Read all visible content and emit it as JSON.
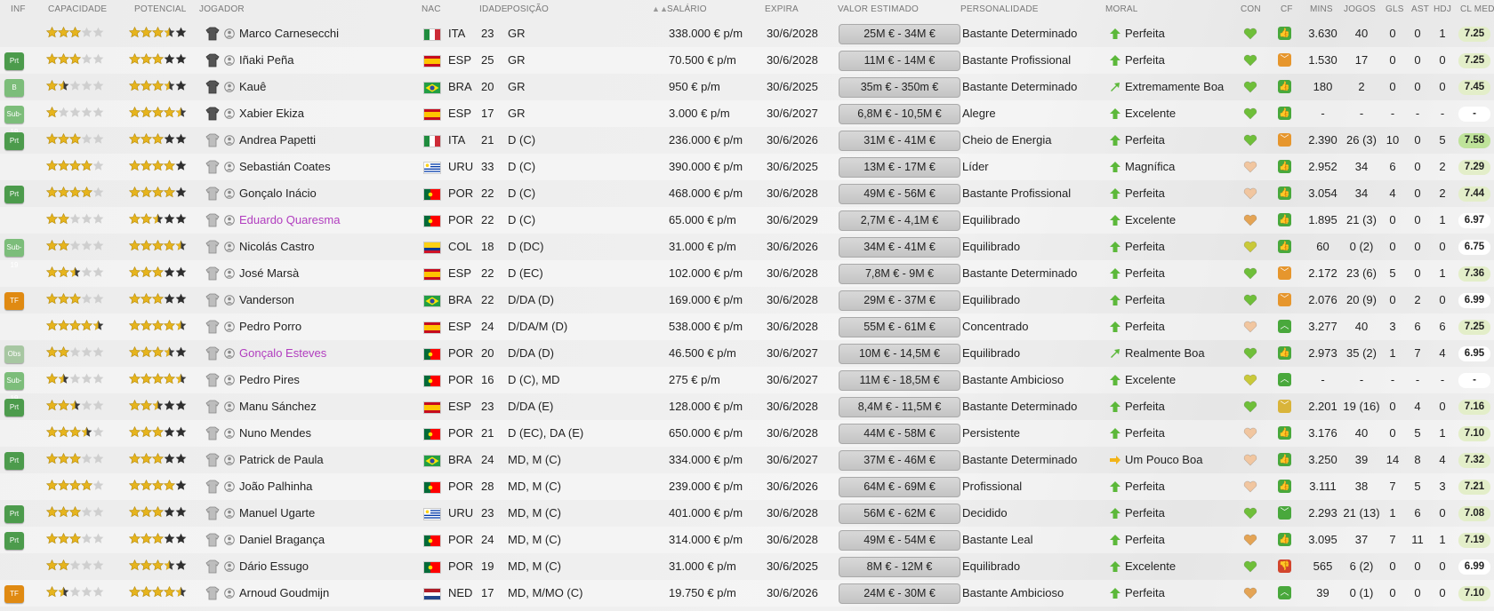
{
  "headers": {
    "inf": "INF",
    "capacidade": "CAPACIDADE",
    "potencial": "POTENCIAL",
    "jogador": "JOGADOR",
    "nac": "NAC",
    "idade": "IDADE",
    "posicao": "POSIÇÃO",
    "salario": "SALÁRIO",
    "expira": "EXPIRA",
    "valor": "VALOR ESTIMADO",
    "personalidade": "PERSONALIDADE",
    "moral": "MORAL",
    "con": "CON",
    "cf": "CF",
    "mins": "MINS",
    "jogos": "JOGOS",
    "gls": "GLS",
    "ast": "AST",
    "hdj": "HDJ",
    "clmed": "CL MED",
    "sort_icon": "sort-ascending-icon"
  },
  "colors": {
    "badge_prt": "#4c9b4c",
    "badge_b": "#7cbd7a",
    "badge_sub19": "#7cbd7a",
    "badge_tf": "#e08a12",
    "badge_obs": "#a7c7a2",
    "star": "#e6b41d",
    "star_empty": "#cfcfcf",
    "pink_name": "#b13dbf",
    "con_green": "#6fbf3a",
    "con_peach": "#f1c6a0",
    "con_orange": "#e4a455",
    "con_yellow": "#c9c93a",
    "cf_green": "#49a83c",
    "cf_orange": "#e6962d",
    "cf_red": "#d2452d",
    "rating_high": "#bfe39a",
    "rating_mid": "#e3eec9",
    "rating_none": "#ffffff"
  },
  "players": [
    {
      "inf": "",
      "cap": 3,
      "pot": 3.5,
      "shirt": "gk",
      "name": "Marco Carnesecchi",
      "pink": false,
      "nat": "ITA",
      "age": "23",
      "pos": "GR",
      "wage": "338.000 € p/m",
      "exp": "30/6/2028",
      "value": "25M € - 34M €",
      "pers": "Bastante Determinado",
      "moral": "Perfeita",
      "moral_icon": "arrow-up-icon",
      "con": "green",
      "cf": "green-up",
      "mins": "3.630",
      "games": "40",
      "gls": "0",
      "ast": "0",
      "hdj": "1",
      "clmed": "7.25",
      "r": "mid"
    },
    {
      "inf": "Prt",
      "cap": 3,
      "pot": 3,
      "shirt": "gk",
      "name": "Iñaki Peña",
      "pink": false,
      "nat": "ESP",
      "age": "25",
      "pos": "GR",
      "wage": "70.500 € p/m",
      "exp": "30/6/2028",
      "value": "11M € - 14M €",
      "pers": "Bastante Profissional",
      "moral": "Perfeita",
      "moral_icon": "arrow-up-icon",
      "con": "green",
      "cf": "orange-down",
      "mins": "1.530",
      "games": "17",
      "gls": "0",
      "ast": "0",
      "hdj": "0",
      "clmed": "7.25",
      "r": "mid"
    },
    {
      "inf": "B",
      "cap": 1.5,
      "pot": 3.5,
      "shirt": "gk",
      "name": "Kauê",
      "pink": false,
      "nat": "BRA",
      "age": "20",
      "pos": "GR",
      "wage": "950 € p/m",
      "exp": "30/6/2025",
      "value": "35m € - 350m €",
      "pers": "Bastante Determinado",
      "moral": "Extremamente Boa",
      "moral_icon": "arrow-right-up-icon",
      "con": "green",
      "cf": "green-up",
      "mins": "180",
      "games": "2",
      "gls": "0",
      "ast": "0",
      "hdj": "0",
      "clmed": "7.45",
      "r": "mid"
    },
    {
      "inf": "Sub-19",
      "cap": 1,
      "pot": 4.5,
      "shirt": "gk",
      "name": "Xabier Ekiza",
      "pink": false,
      "nat": "ESP",
      "age": "17",
      "pos": "GR",
      "wage": "3.000 € p/m",
      "exp": "30/6/2027",
      "value": "6,8M € - 10,5M €",
      "pers": "Alegre",
      "moral": "Excelente",
      "moral_icon": "arrow-up-icon",
      "con": "green",
      "cf": "green-up",
      "mins": "-",
      "games": "-",
      "gls": "-",
      "ast": "-",
      "hdj": "-",
      "clmed": "-",
      "r": "none"
    },
    {
      "inf": "Prt",
      "cap": 3,
      "pot": 3,
      "shirt": "out",
      "name": "Andrea Papetti",
      "pink": false,
      "nat": "ITA",
      "age": "21",
      "pos": "D (C)",
      "wage": "236.000 € p/m",
      "exp": "30/6/2026",
      "value": "31M € - 41M €",
      "pers": "Cheio de Energia",
      "moral": "Perfeita",
      "moral_icon": "arrow-up-icon",
      "con": "green",
      "cf": "orange-down",
      "mins": "2.390",
      "games": "26 (3)",
      "gls": "10",
      "ast": "0",
      "hdj": "5",
      "clmed": "7.58",
      "r": "high"
    },
    {
      "inf": "",
      "cap": 4,
      "pot": 4,
      "shirt": "out",
      "name": "Sebastián Coates",
      "pink": false,
      "nat": "URU",
      "age": "33",
      "pos": "D (C)",
      "wage": "390.000 € p/m",
      "exp": "30/6/2025",
      "value": "13M € - 17M €",
      "pers": "Líder",
      "moral": "Magnífica",
      "moral_icon": "arrow-up-icon",
      "con": "peach",
      "cf": "green-up",
      "mins": "2.952",
      "games": "34",
      "gls": "6",
      "ast": "0",
      "hdj": "2",
      "clmed": "7.29",
      "r": "mid"
    },
    {
      "inf": "Prt",
      "cap": 4,
      "pot": 4,
      "shirt": "out",
      "name": "Gonçalo Inácio",
      "pink": false,
      "nat": "POR",
      "age": "22",
      "pos": "D (C)",
      "wage": "468.000 € p/m",
      "exp": "30/6/2028",
      "value": "49M € - 56M €",
      "pers": "Bastante Profissional",
      "moral": "Perfeita",
      "moral_icon": "arrow-up-icon",
      "con": "peach",
      "cf": "green-up",
      "mins": "3.054",
      "games": "34",
      "gls": "4",
      "ast": "0",
      "hdj": "2",
      "clmed": "7.44",
      "r": "mid"
    },
    {
      "inf": "",
      "cap": 2,
      "pot": 2.5,
      "shirt": "out",
      "name": "Eduardo Quaresma",
      "pink": true,
      "nat": "POR",
      "age": "22",
      "pos": "D (C)",
      "wage": "65.000 € p/m",
      "exp": "30/6/2029",
      "value": "2,7M € - 4,1M €",
      "pers": "Equilibrado",
      "moral": "Excelente",
      "moral_icon": "arrow-up-icon",
      "con": "orange",
      "cf": "green-up",
      "mins": "1.895",
      "games": "21 (3)",
      "gls": "0",
      "ast": "0",
      "hdj": "1",
      "clmed": "6.97",
      "r": "none"
    },
    {
      "inf": "Sub-19",
      "cap": 2,
      "pot": 4.5,
      "shirt": "out",
      "name": "Nicolás Castro",
      "pink": false,
      "nat": "COL",
      "age": "18",
      "pos": "D (DC)",
      "wage": "31.000 € p/m",
      "exp": "30/6/2026",
      "value": "34M € - 41M €",
      "pers": "Equilibrado",
      "moral": "Perfeita",
      "moral_icon": "arrow-up-icon",
      "con": "yellow",
      "cf": "green-up",
      "mins": "60",
      "games": "0 (2)",
      "gls": "0",
      "ast": "0",
      "hdj": "0",
      "clmed": "6.75",
      "r": "none"
    },
    {
      "inf": "",
      "cap": 2.5,
      "pot": 3,
      "shirt": "out",
      "name": "José Marsà",
      "pink": false,
      "nat": "ESP",
      "age": "22",
      "pos": "D (EC)",
      "wage": "102.000 € p/m",
      "exp": "30/6/2028",
      "value": "7,8M € - 9M €",
      "pers": "Bastante Determinado",
      "moral": "Perfeita",
      "moral_icon": "arrow-up-icon",
      "con": "green",
      "cf": "orange-down",
      "mins": "2.172",
      "games": "23 (6)",
      "gls": "5",
      "ast": "0",
      "hdj": "1",
      "clmed": "7.36",
      "r": "mid"
    },
    {
      "inf": "TF",
      "cap": 3,
      "pot": 3,
      "shirt": "out",
      "name": "Vanderson",
      "pink": false,
      "nat": "BRA",
      "age": "22",
      "pos": "D/DA (D)",
      "wage": "169.000 € p/m",
      "exp": "30/6/2028",
      "value": "29M € - 37M €",
      "pers": "Equilibrado",
      "moral": "Perfeita",
      "moral_icon": "arrow-up-icon",
      "con": "green",
      "cf": "orange-down",
      "mins": "2.076",
      "games": "20 (9)",
      "gls": "0",
      "ast": "2",
      "hdj": "0",
      "clmed": "6.99",
      "r": "none"
    },
    {
      "inf": "",
      "cap": 4.5,
      "pot": 4.5,
      "shirt": "out",
      "name": "Pedro Porro",
      "pink": false,
      "nat": "ESP",
      "age": "24",
      "pos": "D/DA/M (D)",
      "wage": "538.000 € p/m",
      "exp": "30/6/2028",
      "value": "55M € - 61M €",
      "pers": "Concentrado",
      "moral": "Perfeita",
      "moral_icon": "arrow-up-icon",
      "con": "peach",
      "cf": "green-chev",
      "mins": "3.277",
      "games": "40",
      "gls": "3",
      "ast": "6",
      "hdj": "6",
      "clmed": "7.25",
      "r": "mid"
    },
    {
      "inf": "Obs",
      "cap": 2,
      "pot": 3.5,
      "shirt": "out",
      "name": "Gonçalo Esteves",
      "pink": true,
      "nat": "POR",
      "age": "20",
      "pos": "D/DA (D)",
      "wage": "46.500 € p/m",
      "exp": "30/6/2027",
      "value": "10M € - 14,5M €",
      "pers": "Equilibrado",
      "moral": "Realmente Boa",
      "moral_icon": "arrow-right-up-icon",
      "con": "green",
      "cf": "green-up",
      "mins": "2.973",
      "games": "35 (2)",
      "gls": "1",
      "ast": "7",
      "hdj": "4",
      "clmed": "6.95",
      "r": "none"
    },
    {
      "inf": "Sub-19",
      "cap": 1.5,
      "pot": 4.5,
      "shirt": "out",
      "name": "Pedro Pires",
      "pink": false,
      "nat": "POR",
      "age": "16",
      "pos": "D (C), MD",
      "wage": "275 € p/m",
      "exp": "30/6/2027",
      "value": "11M € - 18,5M €",
      "pers": "Bastante Ambicioso",
      "moral": "Excelente",
      "moral_icon": "arrow-up-icon",
      "con": "yellow",
      "cf": "green-chev",
      "mins": "-",
      "games": "-",
      "gls": "-",
      "ast": "-",
      "hdj": "-",
      "clmed": "-",
      "r": "none"
    },
    {
      "inf": "Prt",
      "cap": 2.5,
      "pot": 2.5,
      "shirt": "out",
      "name": "Manu Sánchez",
      "pink": false,
      "nat": "ESP",
      "age": "23",
      "pos": "D/DA (E)",
      "wage": "128.000 € p/m",
      "exp": "30/6/2028",
      "value": "8,4M € - 11,5M €",
      "pers": "Bastante Determinado",
      "moral": "Perfeita",
      "moral_icon": "arrow-up-icon",
      "con": "green",
      "cf": "yellow-down",
      "mins": "2.201",
      "games": "19 (16)",
      "gls": "0",
      "ast": "4",
      "hdj": "0",
      "clmed": "7.16",
      "r": "mid"
    },
    {
      "inf": "",
      "cap": 3.5,
      "pot": 3,
      "shirt": "out",
      "name": "Nuno Mendes",
      "pink": false,
      "nat": "POR",
      "age": "21",
      "pos": "D (EC), DA (E)",
      "wage": "650.000 € p/m",
      "exp": "30/6/2028",
      "value": "44M € - 58M €",
      "pers": "Persistente",
      "moral": "Perfeita",
      "moral_icon": "arrow-up-icon",
      "con": "peach",
      "cf": "green-up",
      "mins": "3.176",
      "games": "40",
      "gls": "0",
      "ast": "5",
      "hdj": "1",
      "clmed": "7.10",
      "r": "mid"
    },
    {
      "inf": "Prt",
      "cap": 3,
      "pot": 3,
      "shirt": "out",
      "name": "Patrick de Paula",
      "pink": false,
      "nat": "BRA",
      "age": "24",
      "pos": "MD, M (C)",
      "wage": "334.000 € p/m",
      "exp": "30/6/2027",
      "value": "37M € - 46M €",
      "pers": "Bastante Determinado",
      "moral": "Um Pouco Boa",
      "moral_icon": "arrow-right-icon",
      "con": "peach",
      "cf": "green-up",
      "mins": "3.250",
      "games": "39",
      "gls": "14",
      "ast": "8",
      "hdj": "4",
      "clmed": "7.32",
      "r": "mid"
    },
    {
      "inf": "",
      "cap": 4,
      "pot": 4,
      "shirt": "out",
      "name": "João Palhinha",
      "pink": false,
      "nat": "POR",
      "age": "28",
      "pos": "MD, M (C)",
      "wage": "239.000 € p/m",
      "exp": "30/6/2026",
      "value": "64M € - 69M €",
      "pers": "Profissional",
      "moral": "Perfeita",
      "moral_icon": "arrow-up-icon",
      "con": "peach",
      "cf": "green-up",
      "mins": "3.111",
      "games": "38",
      "gls": "7",
      "ast": "5",
      "hdj": "3",
      "clmed": "7.21",
      "r": "mid"
    },
    {
      "inf": "Prt",
      "cap": 3,
      "pot": 3,
      "shirt": "out",
      "name": "Manuel Ugarte",
      "pink": false,
      "nat": "URU",
      "age": "23",
      "pos": "MD, M (C)",
      "wage": "401.000 € p/m",
      "exp": "30/6/2028",
      "value": "56M € - 62M €",
      "pers": "Decidido",
      "moral": "Perfeita",
      "moral_icon": "arrow-up-icon",
      "con": "green",
      "cf": "green-down",
      "mins": "2.293",
      "games": "21 (13)",
      "gls": "1",
      "ast": "6",
      "hdj": "0",
      "clmed": "7.08",
      "r": "mid"
    },
    {
      "inf": "Prt",
      "cap": 3,
      "pot": 3,
      "shirt": "out",
      "name": "Daniel Bragança",
      "pink": false,
      "nat": "POR",
      "age": "24",
      "pos": "MD, M (C)",
      "wage": "314.000 € p/m",
      "exp": "30/6/2028",
      "value": "49M € - 54M €",
      "pers": "Bastante Leal",
      "moral": "Perfeita",
      "moral_icon": "arrow-up-icon",
      "con": "orange",
      "cf": "green-up",
      "mins": "3.095",
      "games": "37",
      "gls": "7",
      "ast": "11",
      "hdj": "1",
      "clmed": "7.19",
      "r": "mid"
    },
    {
      "inf": "",
      "cap": 2,
      "pot": 3.5,
      "shirt": "out",
      "name": "Dário Essugo",
      "pink": false,
      "nat": "POR",
      "age": "19",
      "pos": "MD, M (C)",
      "wage": "31.000 € p/m",
      "exp": "30/6/2025",
      "value": "8M € - 12M €",
      "pers": "Equilibrado",
      "moral": "Excelente",
      "moral_icon": "arrow-up-icon",
      "con": "green",
      "cf": "red-down",
      "mins": "565",
      "games": "6 (2)",
      "gls": "0",
      "ast": "0",
      "hdj": "0",
      "clmed": "6.99",
      "r": "none"
    },
    {
      "inf": "TF",
      "cap": 1.5,
      "pot": 4.5,
      "shirt": "out",
      "name": "Arnoud Goudmijn",
      "pink": false,
      "nat": "NED",
      "age": "17",
      "pos": "MD, M/MO (C)",
      "wage": "19.750 € p/m",
      "exp": "30/6/2026",
      "value": "24M € - 30M €",
      "pers": "Bastante Ambicioso",
      "moral": "Perfeita",
      "moral_icon": "arrow-up-icon",
      "con": "orange",
      "cf": "green-chev",
      "mins": "39",
      "games": "0 (1)",
      "gls": "0",
      "ast": "0",
      "hdj": "0",
      "clmed": "7.10",
      "r": "mid"
    }
  ]
}
